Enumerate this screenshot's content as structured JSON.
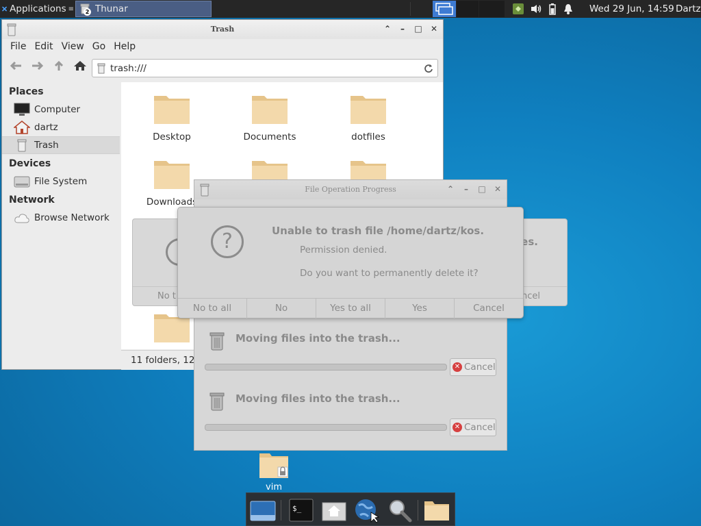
{
  "top_panel": {
    "apps_label": "Applications",
    "task_label": "Thunar",
    "task_badge": "2",
    "clock": "Wed 29 Jun, 14:59",
    "user": "Dartz"
  },
  "thunar": {
    "title": "Trash",
    "menu": [
      "File",
      "Edit",
      "View",
      "Go",
      "Help"
    ],
    "location": "trash:///",
    "sidebar": {
      "places_heading": "Places",
      "places": [
        "Computer",
        "dartz",
        "Trash"
      ],
      "devices_heading": "Devices",
      "devices": [
        "File System"
      ],
      "network_heading": "Network",
      "network": [
        "Browse Network"
      ]
    },
    "folders": [
      "Desktop",
      "Documents",
      "dotfiles",
      "Downloads"
    ],
    "status": "11 folders, 12"
  },
  "back_dialog": {
    "title_fragment": "ies.",
    "no_fragment": "No t",
    "cancel_fragment": "ncel"
  },
  "progress": {
    "title": "File Operation Progress",
    "ops": [
      {
        "label": "Moving files into the trash...",
        "cancel": "Cancel",
        "progress": 0
      },
      {
        "label": "Moving files into the trash...",
        "cancel": "Cancel",
        "progress": 0
      }
    ]
  },
  "error_dialog": {
    "title": "Unable to trash file /home/dartz/kos.",
    "subtitle": "Permission denied.",
    "question": "Do you want to permanently delete it?",
    "buttons": [
      "No to all",
      "No",
      "Yes to all",
      "Yes",
      "Cancel"
    ]
  },
  "desktop": {
    "icon_label": "vim"
  },
  "colors": {
    "panel": "#262626",
    "task_active": "#4a5e84",
    "workspace_active": "#3e7bd3",
    "folder": "#f0d5a4",
    "cancel_red": "#d64040"
  }
}
